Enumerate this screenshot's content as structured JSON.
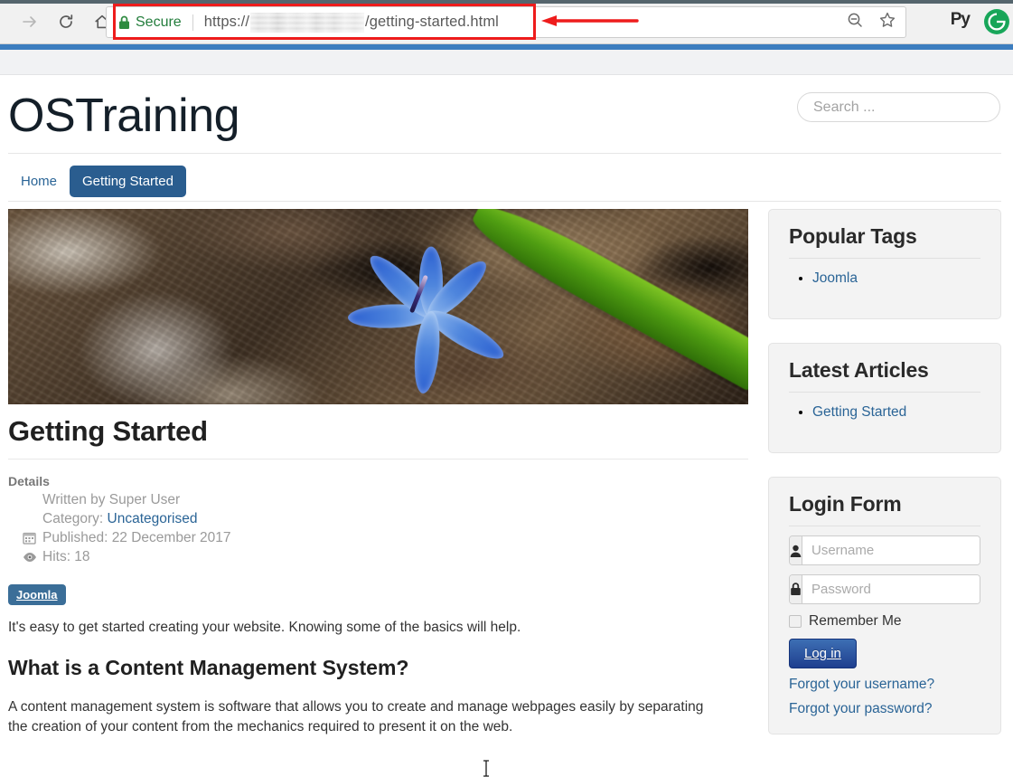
{
  "browser": {
    "nav": {
      "forward_label": "Forward",
      "reload_label": "Reload",
      "home_label": "Home"
    },
    "omnibox": {
      "security_label": "Secure",
      "url_scheme": "https://",
      "url_redacted": "",
      "url_path": "/getting-started.html",
      "lock_icon": "lock-icon",
      "zoom_out_icon": "zoom-out-icon",
      "bookmark_icon": "star-icon"
    },
    "extensions": {
      "py_label": "Py",
      "profile_label": "G"
    },
    "annotation": {
      "box_color": "#ee1c1c",
      "arrow_color": "#ee1c1c"
    }
  },
  "site": {
    "title": "OSTraining",
    "search": {
      "placeholder": "Search ...",
      "value": ""
    },
    "nav": [
      {
        "label": "Home",
        "active": false
      },
      {
        "label": "Getting Started",
        "active": true
      }
    ]
  },
  "article": {
    "hero_alt": "Blue scilla flower among dried leaves",
    "title": "Getting Started",
    "tools_button": "gear-icon",
    "details": {
      "label": "Details",
      "written_by": "Written by Super User",
      "category_label": "Category:",
      "category_value": "Uncategorised",
      "published": "Published: 22 December 2017",
      "hits": "Hits: 18",
      "calendar_icon": "calendar-icon",
      "eye_icon": "eye-icon"
    },
    "tag": "Joomla",
    "intro": "It's easy to get started creating your website. Knowing some of the basics will help.",
    "heading2": "What is a Content Management System?",
    "para2": "A content management system is software that allows you to create and manage webpages easily by separating the creation of your content from the mechanics required to present it on the web."
  },
  "sidebar": {
    "popular_tags": {
      "title": "Popular Tags",
      "items": [
        {
          "label": "Joomla"
        }
      ]
    },
    "latest_articles": {
      "title": "Latest Articles",
      "items": [
        {
          "label": "Getting Started"
        }
      ]
    },
    "login": {
      "title": "Login Form",
      "username_placeholder": "Username",
      "username_value": "",
      "password_placeholder": "Password",
      "password_value": "",
      "user_icon": "user-icon",
      "lock_icon": "lock-icon",
      "remember_label": "Remember Me",
      "remember_checked": false,
      "submit_label": "Log in",
      "forgot_username": "Forgot your username?",
      "forgot_password": "Forgot your password?"
    }
  },
  "colors": {
    "accent_blue": "#2a5d8f",
    "link_blue": "#2a6496",
    "band_blue": "#3c7dbf",
    "secure_green": "#237d3c",
    "annotation_red": "#ee1c1c",
    "tag_blue": "#3b6e98",
    "login_button": "#1f3f8f"
  }
}
